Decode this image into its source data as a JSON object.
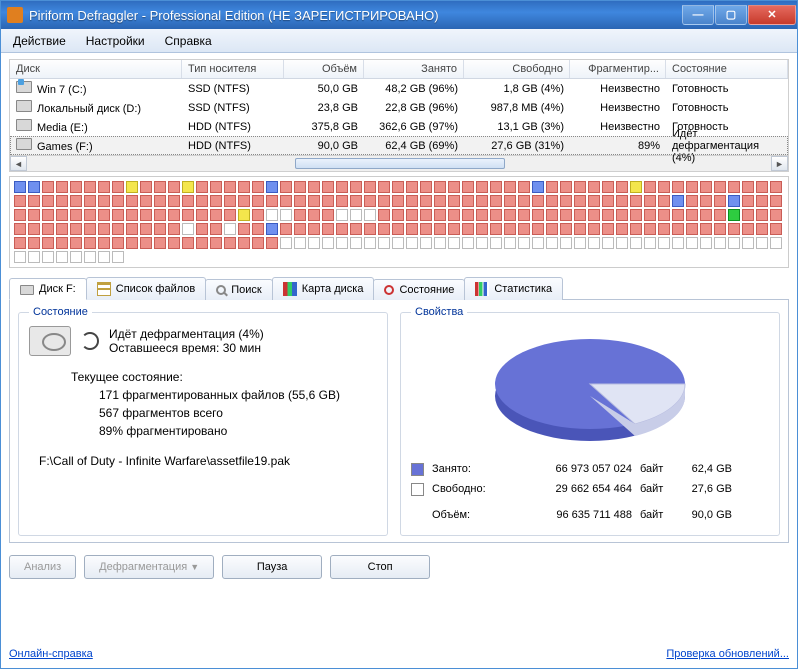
{
  "window": {
    "title": "Piriform Defraggler - Professional Edition (НЕ ЗАРЕГИСТРИРОВАНО)"
  },
  "menu": {
    "action": "Действие",
    "settings": "Настройки",
    "help": "Справка"
  },
  "drive_table": {
    "headers": {
      "disk": "Диск",
      "media": "Тип носителя",
      "size": "Объём",
      "used": "Занято",
      "free": "Свободно",
      "frag": "Фрагментир...",
      "state": "Состояние"
    },
    "rows": [
      {
        "name": "Win 7 (C:)",
        "media": "SSD (NTFS)",
        "size": "50,0 GB",
        "used": "48,2 GB (96%)",
        "free": "1,8 GB (4%)",
        "frag": "Неизвестно",
        "state": "Готовность"
      },
      {
        "name": "Локальный диск (D:)",
        "media": "SSD (NTFS)",
        "size": "23,8 GB",
        "used": "22,8 GB (96%)",
        "free": "987,8 MB (4%)",
        "frag": "Неизвестно",
        "state": "Готовность"
      },
      {
        "name": "Media (E:)",
        "media": "HDD (NTFS)",
        "size": "375,8 GB",
        "used": "362,6 GB (97%)",
        "free": "13,1 GB (3%)",
        "frag": "Неизвестно",
        "state": "Готовность"
      },
      {
        "name": "Games (F:)",
        "media": "HDD (NTFS)",
        "size": "90,0 GB",
        "used": "62,4 GB (69%)",
        "free": "27,6 GB (31%)",
        "frag": "89%",
        "state": "Идёт дефрагментация (4%)"
      }
    ]
  },
  "tabs": {
    "disk": "Диск F:",
    "files": "Список файлов",
    "search": "Поиск",
    "map": "Карта диска",
    "status": "Состояние",
    "stats": "Статистика"
  },
  "status_panel": {
    "legend": "Состояние",
    "line1": "Идёт дефрагментация (4%)",
    "line2": "Оставшееся время: 30 мин",
    "current": "Текущее состояние:",
    "frag_files": "171  фрагментированных файлов (55,6 GB)",
    "fragments": "567  фрагментов всего",
    "percent": "89%  фрагментировано",
    "filepath": "F:\\Call of Duty - Infinite Warfare\\assetfile19.pak"
  },
  "props_panel": {
    "legend": "Свойства",
    "used_label": "Занято:",
    "used_bytes": "66 973 057 024",
    "used_h": "62,4 GB",
    "free_label": "Свободно:",
    "free_bytes": "29 662 654 464",
    "free_h": "27,6 GB",
    "total_label": "Объём:",
    "total_bytes": "96 635 711 488",
    "total_h": "90,0 GB",
    "byte_unit": "байт"
  },
  "buttons": {
    "analyze": "Анализ",
    "defrag": "Дефрагментация",
    "pause": "Пауза",
    "stop": "Стоп"
  },
  "footer": {
    "help": "Онлайн-справка",
    "updates": "Проверка обновлений..."
  },
  "chart_data": {
    "type": "pie",
    "title": "Свойства",
    "series": [
      {
        "name": "Занято",
        "value": 66973057024,
        "human": "62,4 GB",
        "color": "#6772d6"
      },
      {
        "name": "Свободно",
        "value": 29662654464,
        "human": "27,6 GB",
        "color": "#e0e4f4"
      }
    ],
    "total": {
      "name": "Объём",
      "value": 96635711488,
      "human": "90,0 GB"
    }
  },
  "drivemap_pattern": "bbrrrrrryrrryrrrrrbrrrrrrrrrrrrrrrrrrbrrrrrryrrrrrrrrrrrrrrrrrrrrrrrrrrrrrrrrrrrrrrrrrrrrrrrrrrrrrrrrrbrrrbrrrrrrrrrrrrrrrrrrryrwwrrrwwwrrrrrrrrrrrrrrrrrrrrrrrrrgrrrrrrrrrrrrrrrwrrwrrbrrrrrrrrrrrrrrrrrrrrrrrrrrrrrrrrrrrrrrrrrrrrrrrrrrrrrrrwwwwwwwwwwwwwwwwwwwwwwwwwwwwwwwwwwwwwwwwwwww"
}
